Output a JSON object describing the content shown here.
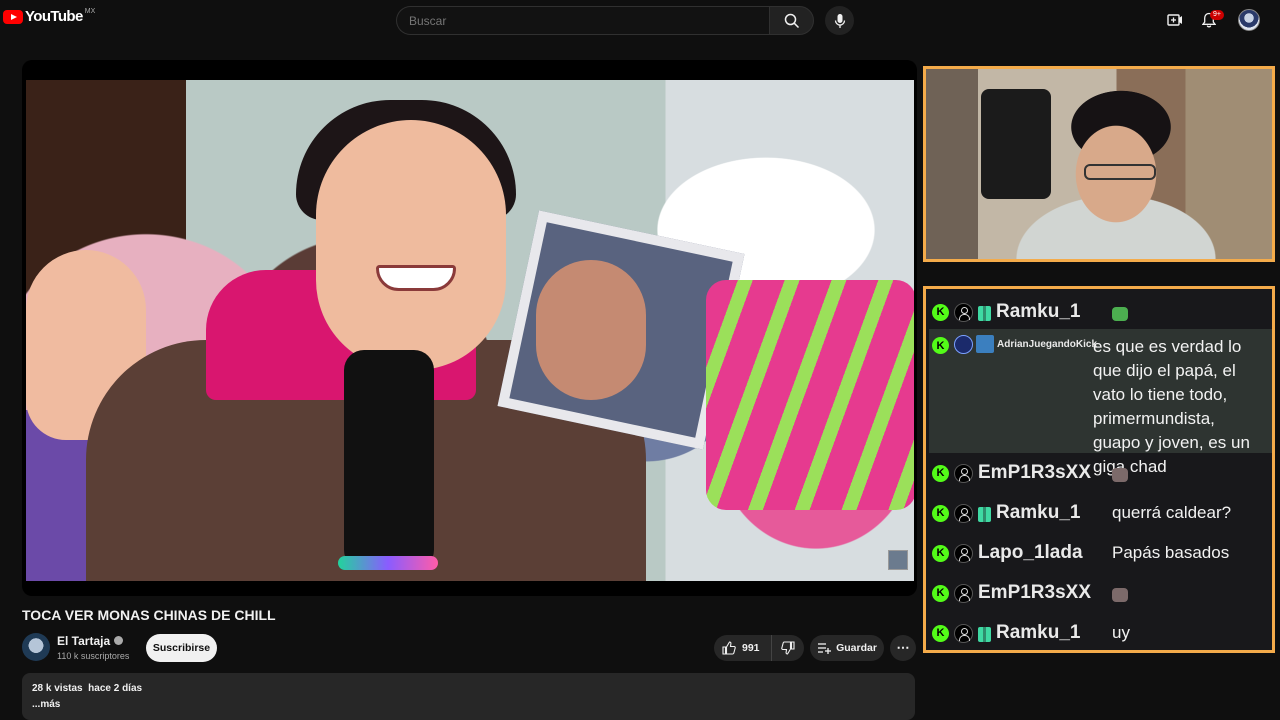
{
  "app": {
    "logo_text": "YouTube",
    "region": "MX"
  },
  "search": {
    "placeholder": "Buscar"
  },
  "header": {
    "notifications_badge": "9+"
  },
  "video": {
    "title": "TOCA VER MONAS CHINAS DE CHILL",
    "channel_name": "El Tartaja",
    "subscribers": "110 k suscriptores",
    "subscribe_label": "Suscribirse",
    "likes": "991",
    "save_label": "Guardar",
    "more_label": "⋯",
    "views_date": "28 k vistas  hace 2 días",
    "desc_more": "...más"
  },
  "chat": {
    "messages": [
      {
        "user": "Ramku_1",
        "text": "",
        "emote_color": "#4caf50"
      },
      {
        "user": "AdrianJuegandoKick",
        "text": "es que es verdad lo que dijo el papá, el vato lo tiene todo, primermundista, guapo y joven, es un giga chad"
      },
      {
        "user": "EmP1R3sXX",
        "text": "",
        "emote_color": "#7c6a6a"
      },
      {
        "user": "Ramku_1",
        "text": "querrá caldear?"
      },
      {
        "user": "Lapo_1lada",
        "text": "Papás basados"
      },
      {
        "user": "EmP1R3sXX",
        "text": "",
        "emote_color": "#7c6a6a"
      },
      {
        "user": "Ramku_1",
        "text": "uy"
      }
    ]
  },
  "colors": {
    "accent": "#ff0000",
    "overlay_border": "#f4ab4a",
    "kick_green": "#53fc18"
  },
  "icons": [
    "youtube-logo-icon",
    "search-icon",
    "mic-icon",
    "create-icon",
    "bell-icon",
    "like-icon",
    "dislike-icon",
    "save-icon",
    "kick-icon",
    "user-icon",
    "gift-icon"
  ]
}
